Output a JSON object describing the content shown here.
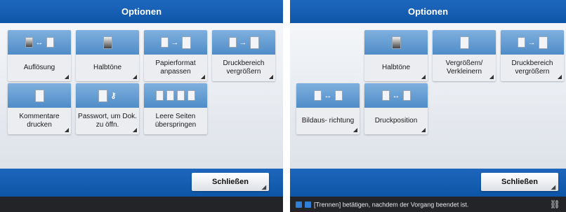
{
  "left": {
    "title": "Optionen",
    "tiles": [
      {
        "label": "Auflösung"
      },
      {
        "label": "Halbtöne"
      },
      {
        "label": "Papierformat anpassen"
      },
      {
        "label": "Druckbereich vergrößern"
      },
      {
        "label": "Kommentare drucken"
      },
      {
        "label": "Passwort, um Dok. zu öffn."
      },
      {
        "label": "Leere Seiten überspringen"
      }
    ],
    "close_label": "Schließen"
  },
  "right": {
    "title": "Optionen",
    "tiles": [
      {
        "label": "Halbtöne"
      },
      {
        "label": "Vergrößern/ Verkleinern"
      },
      {
        "label": "Druckbereich vergrößern"
      },
      {
        "label": "Bildaus- richtung"
      },
      {
        "label": "Druckposition"
      }
    ],
    "close_label": "Schließen",
    "status_text": "[Trennen] betätigen, nachdem der Vorgang beendet ist."
  },
  "colors": {
    "accent": "#0d56a8",
    "tile_icon": "#4f8cc8",
    "status_bg": "#222428"
  },
  "icons": {
    "tile_corner": "corner-mark-icon",
    "network": "network-icon"
  }
}
